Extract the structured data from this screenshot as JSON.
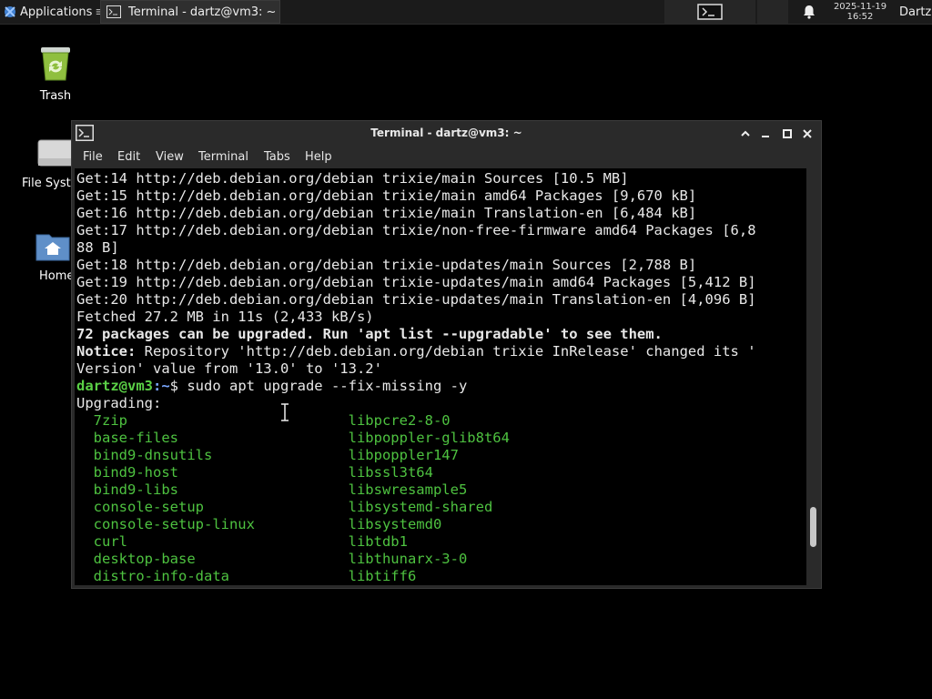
{
  "panel": {
    "apps_label": "Applications",
    "task_label": "Terminal - dartz@vm3: ~",
    "clock_date": "2025-11-19",
    "clock_time": "16:52",
    "user_label": "Dartz"
  },
  "desktop": {
    "trash_label": "Trash",
    "filesystem_label": "File Syst",
    "home_label": "Home"
  },
  "window": {
    "title": "Terminal - dartz@vm3: ~",
    "menu": [
      "File",
      "Edit",
      "View",
      "Terminal",
      "Tabs",
      "Help"
    ]
  },
  "terminal": {
    "lines": [
      {
        "t": "Get:14 http://deb.debian.org/debian trixie/main Sources [10.5 MB]"
      },
      {
        "t": "Get:15 http://deb.debian.org/debian trixie/main amd64 Packages [9,670 kB]"
      },
      {
        "t": "Get:16 http://deb.debian.org/debian trixie/main Translation-en [6,484 kB]"
      },
      {
        "t": "Get:17 http://deb.debian.org/debian trixie/non-free-firmware amd64 Packages [6,8"
      },
      {
        "t": "88 B]"
      },
      {
        "t": "Get:18 http://deb.debian.org/debian trixie-updates/main Sources [2,788 B]"
      },
      {
        "t": "Get:19 http://deb.debian.org/debian trixie-updates/main amd64 Packages [5,412 B]"
      },
      {
        "t": "Get:20 http://deb.debian.org/debian trixie-updates/main Translation-en [4,096 B]"
      },
      {
        "t": "Fetched 27.2 MB in 11s (2,433 kB/s)"
      },
      {
        "t": "72 packages can be upgraded. Run 'apt list --upgradable' to see them.",
        "bold": true
      },
      {
        "notice": "Notice:",
        "t": " Repository 'http://deb.debian.org/debian trixie InRelease' changed its '"
      },
      {
        "t": "Version' value from '13.0' to '13.2'"
      },
      {
        "prompt_user": "dartz@vm3",
        "prompt_path": ":~",
        "t": "$ sudo apt upgrade --fix-missing -y"
      },
      {
        "t": "Upgrading:"
      }
    ],
    "packages_left": [
      "7zip",
      "base-files",
      "bind9-dnsutils",
      "bind9-host",
      "bind9-libs",
      "console-setup",
      "console-setup-linux",
      "curl",
      "desktop-base",
      "distro-info-data"
    ],
    "packages_right": [
      "libpcre2-8-0",
      "libpoppler-glib8t64",
      "libpoppler147",
      "libssl3t64",
      "libswresample5",
      "libsystemd-shared",
      "libsystemd0",
      "libtdb1",
      "libthunarx-3-0",
      "libtiff6"
    ]
  }
}
